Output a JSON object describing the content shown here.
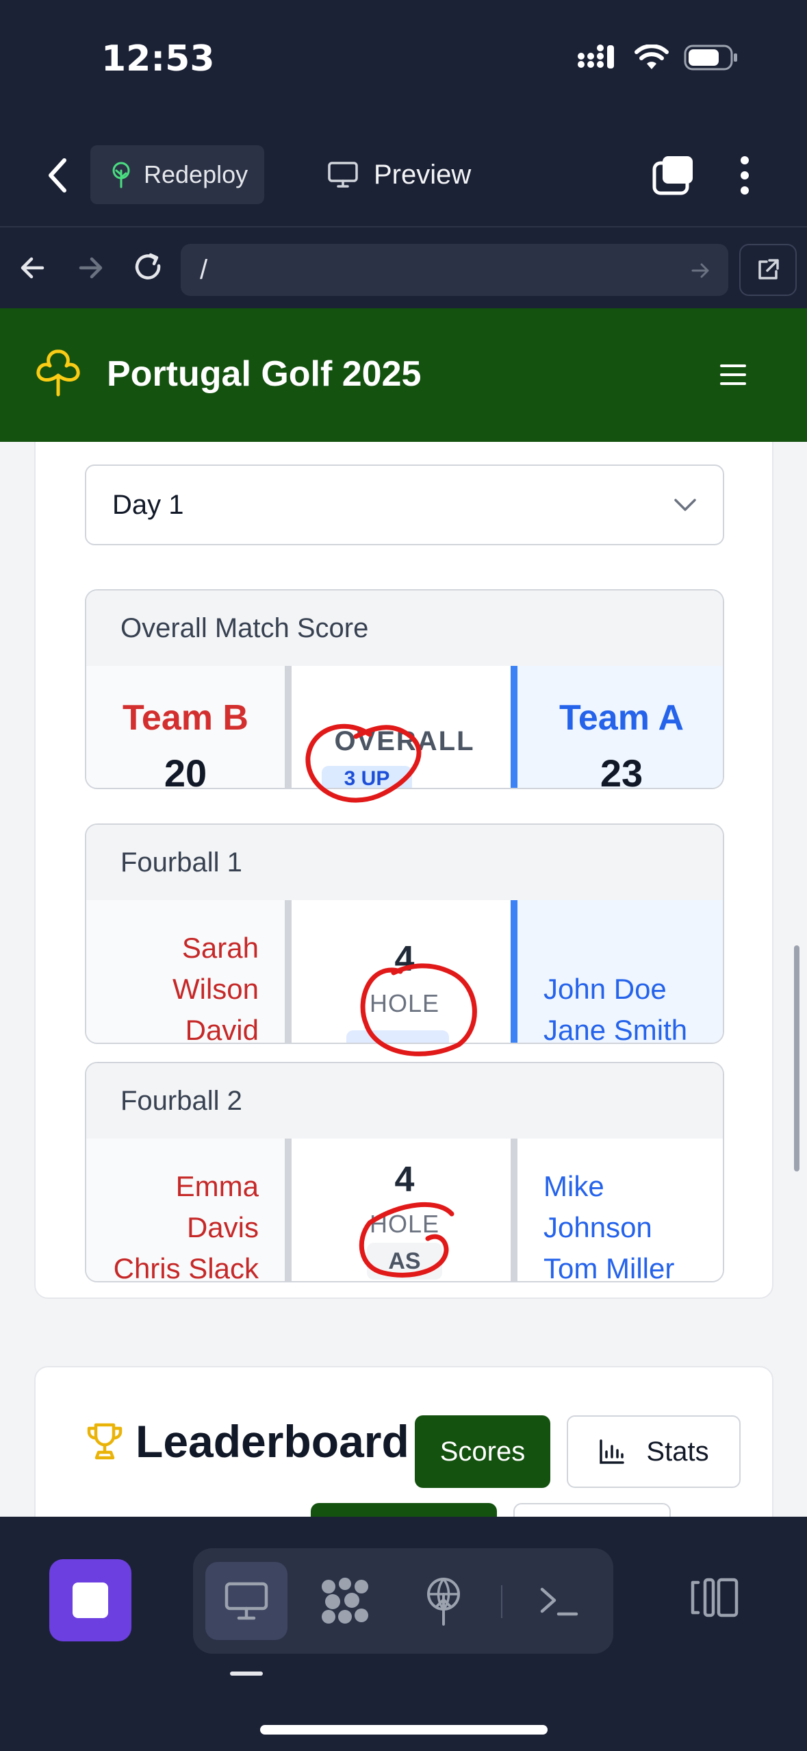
{
  "status_bar": {
    "time": "12:53"
  },
  "replit": {
    "redeploy_label": "Redeploy",
    "preview_label": "Preview",
    "url": "/"
  },
  "app": {
    "title": "Portugal Golf 2025",
    "day_select": "Day 1",
    "overall": {
      "header": "Overall Match Score",
      "team_left": {
        "name": "Team B",
        "score": "20",
        "color": "#d32f2f"
      },
      "center_label": "OVERALL",
      "center_status": "3 UP",
      "team_right": {
        "name": "Team A",
        "score": "23",
        "color": "#2563eb"
      }
    },
    "fourballs": [
      {
        "header": "Fourball 1",
        "left_players": [
          "Sarah",
          "Wilson",
          "David"
        ],
        "hole": "4",
        "hole_label": "HOLE",
        "right_players": [
          "John Doe",
          "Jane Smith"
        ],
        "status": ""
      },
      {
        "header": "Fourball 2",
        "left_players": [
          "Emma",
          "Davis",
          "Chris Slack"
        ],
        "hole": "4",
        "hole_label": "HOLE",
        "right_players": [
          "Mike",
          "Johnson",
          "Tom Miller"
        ],
        "status": "AS"
      }
    ],
    "leaderboard": {
      "title": "Leaderboard",
      "scores_btn": "Scores",
      "stats_btn": "Stats"
    }
  },
  "colors": {
    "brand_green": "#14520f",
    "team_b_red": "#c62828",
    "team_a_blue": "#2563eb",
    "annotation_red": "#e11919",
    "replit_purple": "#6c3fe0"
  },
  "icons": [
    "chevron-left-icon",
    "plant-icon",
    "monitor-icon",
    "tabs-icon",
    "kebab-icon",
    "arrow-left-icon",
    "arrow-right-icon",
    "refresh-icon",
    "external-link-icon",
    "clover-icon",
    "menu-icon",
    "chevron-down-icon",
    "trophy-icon",
    "bar-chart-icon",
    "stop-icon",
    "desktop-icon",
    "packages-icon",
    "deploy-icon",
    "terminal-icon",
    "layout-icon"
  ]
}
